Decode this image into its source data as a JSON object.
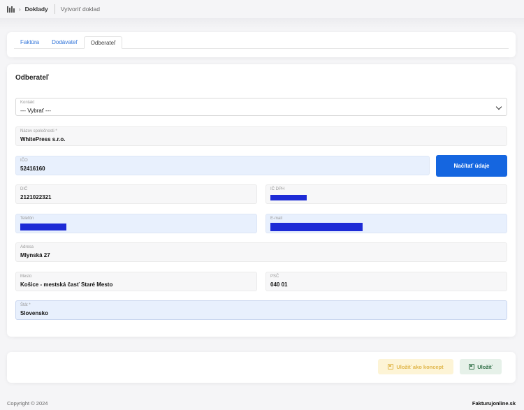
{
  "breadcrumb": {
    "home_icon": "building-icon",
    "section": "Doklady",
    "current": "Vytvoriť doklad"
  },
  "tabs": [
    {
      "label": "Faktúra",
      "active": false
    },
    {
      "label": "Dodávateľ",
      "active": false
    },
    {
      "label": "Odberateľ",
      "active": true
    }
  ],
  "form": {
    "title": "Odberateľ",
    "kontakt": {
      "label": "Kontakt",
      "value": "--- Vybrať ---"
    },
    "nazov": {
      "label": "Názov spoločnosti *",
      "value": "WhitePress s.r.o."
    },
    "ico": {
      "label": "IČO",
      "value": "52416160"
    },
    "load_button": "Načítať údaje",
    "dic": {
      "label": "DIČ",
      "value": "2121022321"
    },
    "ic_dph": {
      "label": "IČ DPH"
    },
    "telefon": {
      "label": "Telefón"
    },
    "email": {
      "label": "E-mail"
    },
    "adresa": {
      "label": "Adresa",
      "value": "Mlynská 27"
    },
    "mesto": {
      "label": "Mesto",
      "value": "Košice - mestská časť Staré Mesto"
    },
    "psc": {
      "label": "PSČ",
      "value": "040 01"
    },
    "stat": {
      "label": "Štát *",
      "value": "Slovensko"
    }
  },
  "actions": {
    "draft": "Uložiť ako koncept",
    "save": "Uložiť"
  },
  "footer": {
    "copyright": "Copyright © 2024",
    "brand": "Fakturujonline.sk"
  },
  "colors": {
    "primary": "#1566e0",
    "redaction": "#1d2bd6",
    "highlight": "#e8f0fd"
  }
}
